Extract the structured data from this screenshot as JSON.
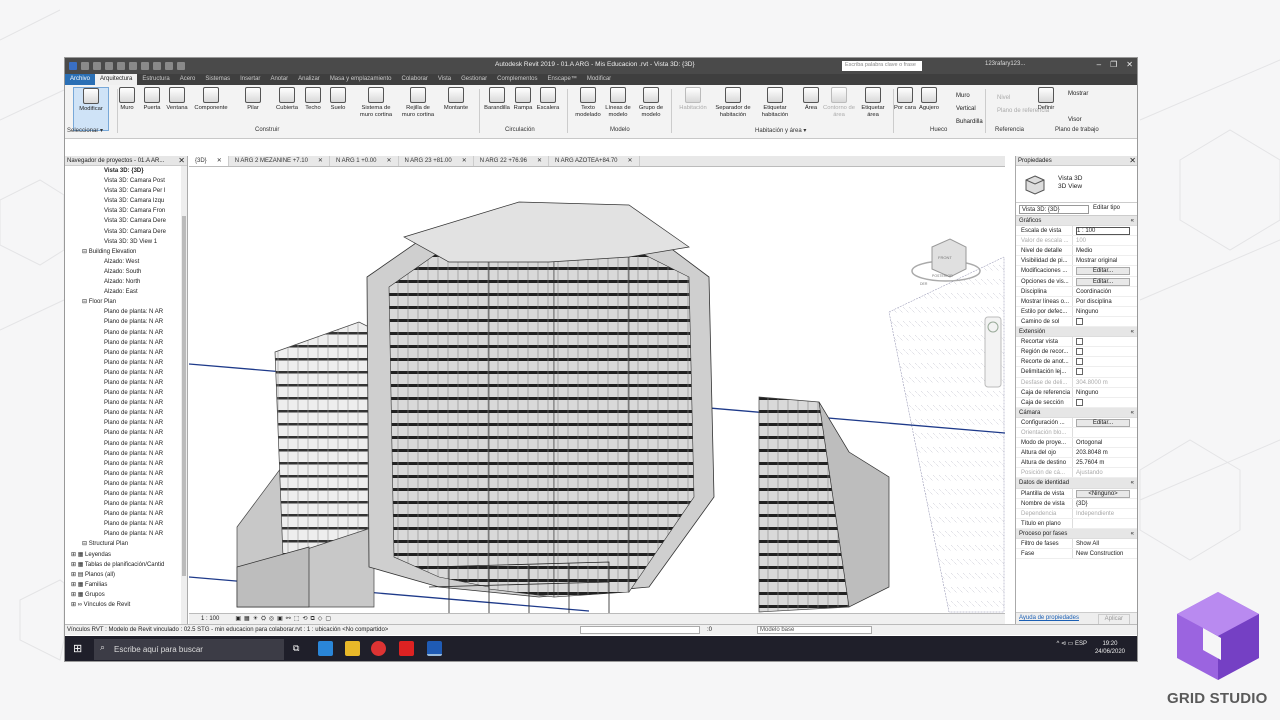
{
  "window": {
    "title": "Autodesk Revit 2019 - 01.A ARG - Mis Educacion .rvt - Vista 3D: {3D}",
    "search_placeholder": "Escriba palabra clave o frase",
    "user": "123rafary123..."
  },
  "tabs": [
    "Archivo",
    "Arquitectura",
    "Estructura",
    "Acero",
    "Sistemas",
    "Insertar",
    "Anotar",
    "Analizar",
    "Masa y emplazamiento",
    "Colaborar",
    "Vista",
    "Gestionar",
    "Complementos",
    "Enscape™",
    "Modificar"
  ],
  "ribbon": {
    "modificar": "Modificar",
    "seleccionar": "Seleccionar ▾",
    "build": [
      "Muro",
      "Puerta",
      "Ventana",
      "Componente",
      "Pilar",
      "Cubierta",
      "Techo",
      "Suelo",
      "Sistema de muro cortina",
      "Rejilla de muro cortina",
      "Montante"
    ],
    "circ": [
      "Barandilla",
      "Rampa",
      "Escalera"
    ],
    "model": [
      "Texto modelado",
      "Líneas de modelo",
      "Grupo de modelo"
    ],
    "room": [
      "Habitación",
      "Separador de habitación",
      "Etiquetar habitación",
      "Área",
      "Contorno de área",
      "Etiquetar área"
    ],
    "opening": [
      "Por cara",
      "Agujero"
    ],
    "opening_small": [
      "Muro",
      "Vertical",
      "Buhardilla"
    ],
    "datum": [
      "Nivel",
      "Plano de referencia"
    ],
    "workplane": [
      "Definir",
      "Mostrar",
      "Visor"
    ],
    "panels": [
      "Construir",
      "Circulación",
      "Modelo",
      "Habitación y área ▾",
      "Hueco",
      "Referencia",
      "Plano de trabajo"
    ]
  },
  "browser": {
    "title": "Navegador de proyectos - 01.A AR...",
    "close": "✕",
    "items": [
      {
        "t": "Vista 3D: {3D}",
        "l": 3,
        "b": true
      },
      {
        "t": "Vista 3D: Camara Post",
        "l": 3
      },
      {
        "t": "Vista 3D: Camara Per I",
        "l": 3
      },
      {
        "t": "Vista 3D: Camara Izqu",
        "l": 3
      },
      {
        "t": "Vista 3D: Camara Fron",
        "l": 3
      },
      {
        "t": "Vista 3D: Camara Dere",
        "l": 3
      },
      {
        "t": "Vista 3D: Camara Dere",
        "l": 3
      },
      {
        "t": "Vista 3D: 3D View 1",
        "l": 3
      },
      {
        "t": "⊟ Building Elevation",
        "l": 1
      },
      {
        "t": "Alzado: West",
        "l": 3
      },
      {
        "t": "Alzado: South",
        "l": 3
      },
      {
        "t": "Alzado: North",
        "l": 3
      },
      {
        "t": "Alzado: East",
        "l": 3
      },
      {
        "t": "⊟ Floor Plan",
        "l": 1
      },
      {
        "t": "Plano de planta: N AR",
        "l": 3
      },
      {
        "t": "Plano de planta: N AR",
        "l": 3
      },
      {
        "t": "Plano de planta: N AR",
        "l": 3
      },
      {
        "t": "Plano de planta: N AR",
        "l": 3
      },
      {
        "t": "Plano de planta: N AR",
        "l": 3
      },
      {
        "t": "Plano de planta: N AR",
        "l": 3
      },
      {
        "t": "Plano de planta: N AR",
        "l": 3
      },
      {
        "t": "Plano de planta: N AR",
        "l": 3
      },
      {
        "t": "Plano de planta: N AR",
        "l": 3
      },
      {
        "t": "Plano de planta: N AR",
        "l": 3
      },
      {
        "t": "Plano de planta: N AR",
        "l": 3
      },
      {
        "t": "Plano de planta: N AR",
        "l": 3
      },
      {
        "t": "Plano de planta: N AR",
        "l": 3
      },
      {
        "t": "Plano de planta: N AR",
        "l": 3
      },
      {
        "t": "Plano de planta: N AR",
        "l": 3
      },
      {
        "t": "Plano de planta: N AR",
        "l": 3
      },
      {
        "t": "Plano de planta: N AR",
        "l": 3
      },
      {
        "t": "Plano de planta: N AR",
        "l": 3
      },
      {
        "t": "Plano de planta: N AR",
        "l": 3
      },
      {
        "t": "Plano de planta: N AR",
        "l": 3
      },
      {
        "t": "Plano de planta: N AR",
        "l": 3
      },
      {
        "t": "Plano de planta: N AR",
        "l": 3
      },
      {
        "t": "Plano de planta: N AR",
        "l": 3
      },
      {
        "t": "⊟ Structural Plan",
        "l": 1
      },
      {
        "t": "⊞ ▦ Leyendas",
        "l": 0
      },
      {
        "t": "⊞ ▦ Tablas de planificación/Cantid",
        "l": 0
      },
      {
        "t": "⊞ ▤ Planos (all)",
        "l": 0
      },
      {
        "t": "⊞ ▦ Familias",
        "l": 0
      },
      {
        "t": "⊞ ▦ Grupos",
        "l": 0
      },
      {
        "t": "⊞ ∞ Vínculos de Revit",
        "l": 0
      }
    ]
  },
  "view_tabs": [
    {
      "label": "{3D}",
      "close": "✕",
      "active": true
    },
    {
      "label": "N ARG 2 MEZANINE +7.10",
      "close": "✕"
    },
    {
      "label": "N ARG 1 +0.00",
      "close": "✕"
    },
    {
      "label": "N ARG 23 +81.00",
      "close": "✕"
    },
    {
      "label": "N ARG 22 +76.96",
      "close": "✕"
    },
    {
      "label": "N ARG AZOTEA+84.70",
      "close": "✕"
    }
  ],
  "viewcube": {
    "front": "FRONT",
    "posterior": "POSTERIOR",
    "side": "DER"
  },
  "view_bar": {
    "scale": "1 : 100"
  },
  "properties": {
    "title": "Propiedades",
    "close": "✕",
    "type1": "Vista 3D",
    "type2": "3D View",
    "selector": "Vista 3D: {3D}",
    "edit_type": "Editar tipo",
    "sections": [
      {
        "name": "Gráficos",
        "rows": [
          [
            "Escala de vista",
            "1 : 100",
            "input"
          ],
          [
            "Valor de escala ...",
            "100",
            "dis"
          ],
          [
            "Nivel de detalle",
            "Medio"
          ],
          [
            "Visibilidad de pi...",
            "Mostrar original"
          ],
          [
            "Modificaciones ...",
            "Editar...",
            "btn"
          ],
          [
            "Opciones de vis...",
            "Editar...",
            "btn"
          ],
          [
            "Disciplina",
            "Coordinación"
          ],
          [
            "Mostrar líneas o...",
            "Por disciplina"
          ],
          [
            "Estilo por defec...",
            "Ninguno"
          ],
          [
            "Camino de sol",
            "",
            "chk"
          ]
        ]
      },
      {
        "name": "Extensión",
        "rows": [
          [
            "Recortar vista",
            "",
            "chk"
          ],
          [
            "Región de recor...",
            "",
            "chk"
          ],
          [
            "Recorte de anot...",
            "",
            "chk"
          ],
          [
            "Delimitación lej...",
            "",
            "chk"
          ],
          [
            "Desfase de deli...",
            "304.8000 m",
            "dis"
          ],
          [
            "Caja de referencia",
            "Ninguno"
          ],
          [
            "Caja de sección",
            "",
            "chk"
          ]
        ]
      },
      {
        "name": "Cámara",
        "rows": [
          [
            "Configuración ...",
            "Editar...",
            "btn"
          ],
          [
            "Orientación blo...",
            "",
            "dis"
          ],
          [
            "Modo de proye...",
            "Ortogonal"
          ],
          [
            "Altura del ojo",
            "203.8048 m"
          ],
          [
            "Altura de destino",
            "25.7604 m"
          ],
          [
            "Posición de cá...",
            "Ajustando",
            "dis"
          ]
        ]
      },
      {
        "name": "Datos de identidad",
        "rows": [
          [
            "Plantilla de vista",
            "<Ninguno>",
            "btn"
          ],
          [
            "Nombre de vista",
            "{3D}"
          ],
          [
            "Dependencia",
            "Independiente",
            "dis"
          ],
          [
            "Título en plano",
            ""
          ]
        ]
      },
      {
        "name": "Proceso por fases",
        "rows": [
          [
            "Filtro de fases",
            "Show All"
          ],
          [
            "Fase",
            "New Construction"
          ]
        ]
      }
    ],
    "help_link": "Ayuda de propiedades",
    "apply": "Aplicar"
  },
  "status": {
    "text": "Vínculos RVT : Modelo de Revit vinculado : 02.5 STG - min educacion para colaborar.rvt : 1 : ubicación <No compartido>",
    "zero": ":0",
    "model_base": "Modelo base"
  },
  "taskbar": {
    "search": "Escribe aquí para buscar",
    "lang": "ESP",
    "time": "19:20",
    "date": "24/06/2020"
  },
  "brand": {
    "name": "GRID STUDIO"
  },
  "colors": {
    "file_tab": "#2a6fb5",
    "logo_purple": "#8a4fd6",
    "model_line": "#1e3a8a"
  }
}
